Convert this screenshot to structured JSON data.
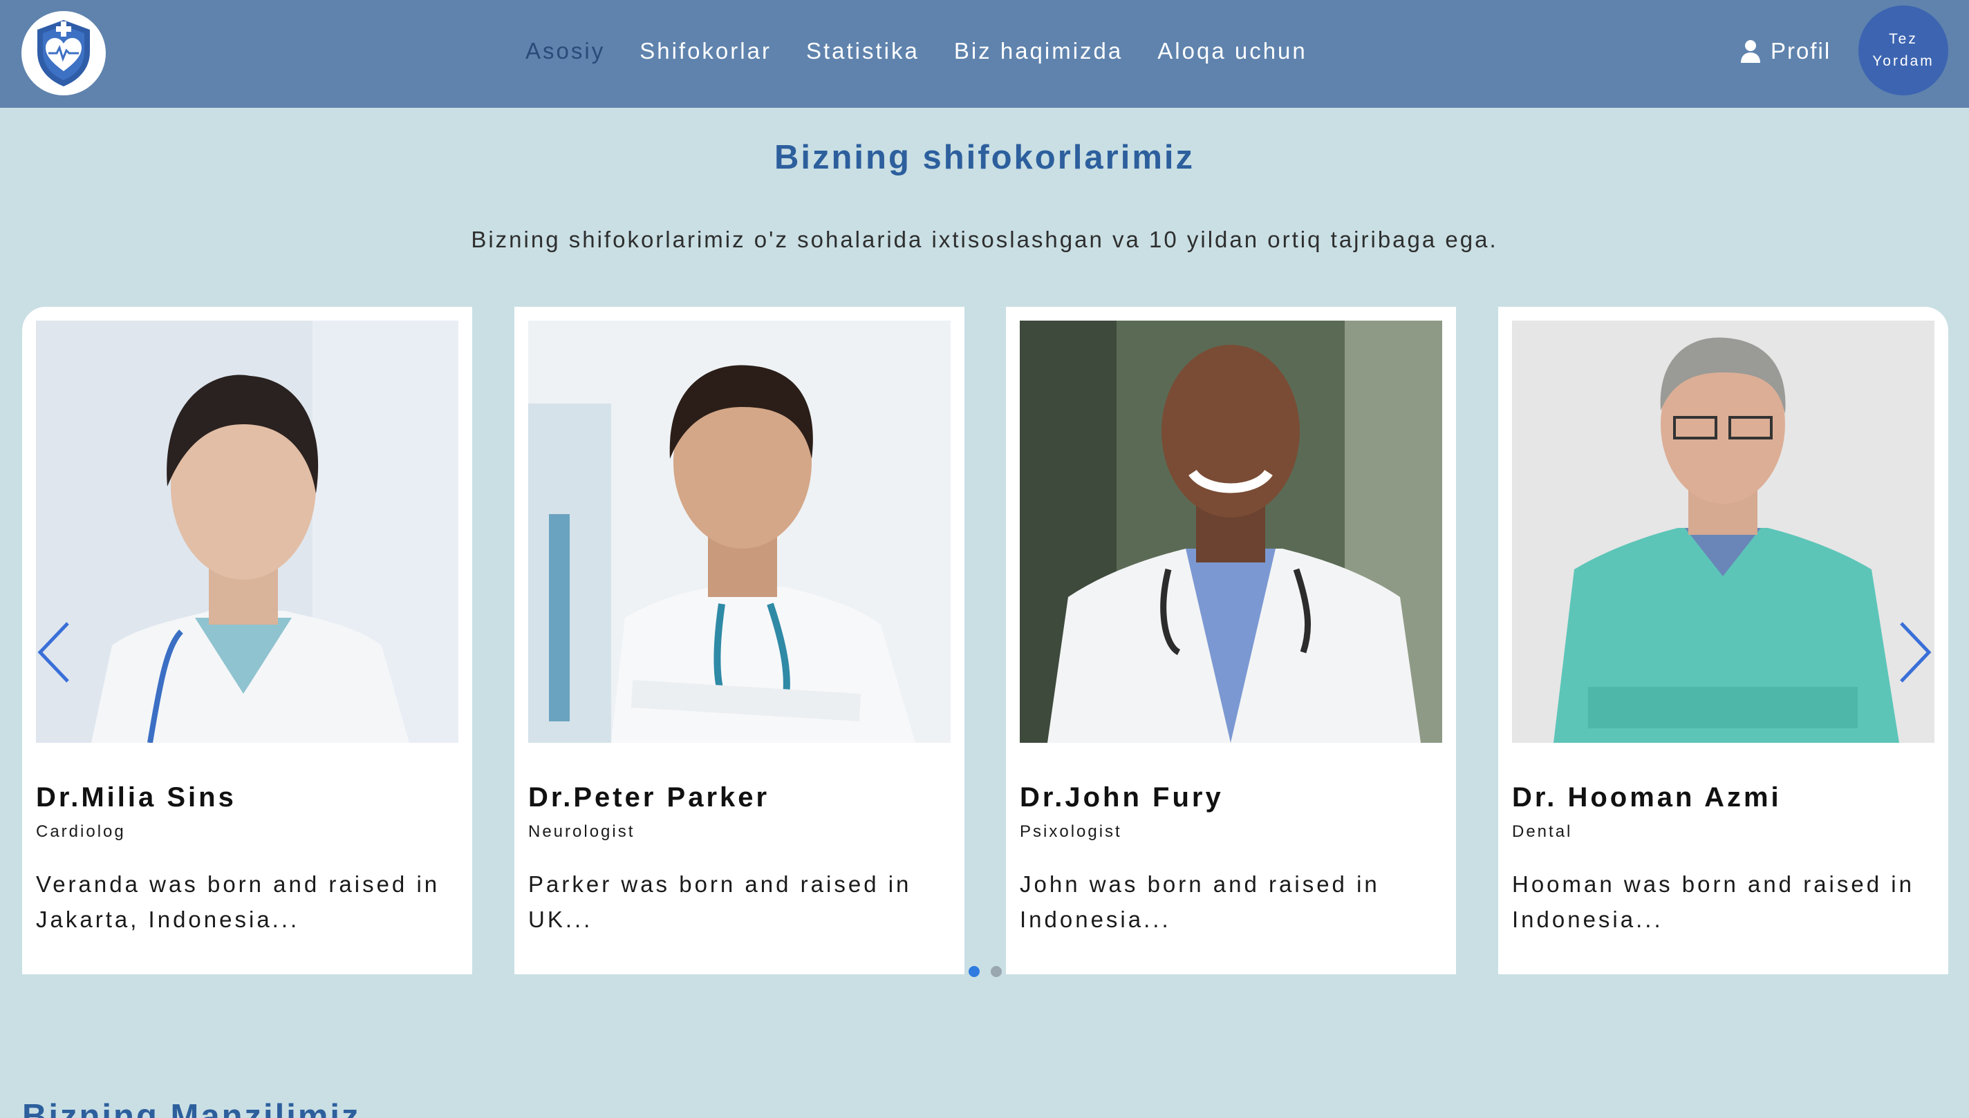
{
  "header": {
    "logo_icon": "shield-heart-cross-icon",
    "nav": [
      {
        "label": "Asosiy",
        "active": true
      },
      {
        "label": "Shifokorlar",
        "active": false
      },
      {
        "label": "Statistika",
        "active": false
      },
      {
        "label": "Biz haqimizda",
        "active": false
      },
      {
        "label": "Aloqa uchun",
        "active": false
      }
    ],
    "profile_label": "Profil",
    "emergency": {
      "line1": "Tez",
      "line2": "Yordam"
    }
  },
  "section": {
    "title": "Bizning shifokorlarimiz",
    "subtitle": "Bizning shifokorlarimiz o'z sohalarida ixtisoslashgan va 10 yildan ortiq tajribaga ega."
  },
  "doctors": [
    {
      "name": "Dr.Milia Sins",
      "specialty": "Cardiolog",
      "bio": "Veranda was born and raised in Jakarta, Indonesia..."
    },
    {
      "name": "Dr.Peter Parker",
      "specialty": "Neurologist",
      "bio": "Parker was born and raised in UK..."
    },
    {
      "name": "Dr.John Fury",
      "specialty": "Psixologist",
      "bio": "John was born and raised in Indonesia..."
    },
    {
      "name": "Dr. Hooman Azmi",
      "specialty": "Dental",
      "bio": "Hooman was born and raised in Indonesia..."
    }
  ],
  "carousel": {
    "pages": 2,
    "active_page": 1
  },
  "next_section_title": "Bizning Manzilimiz",
  "colors": {
    "header_bg": "#5f83ad",
    "page_bg": "#c9dfe4",
    "title": "#2d5f9d",
    "emergency_bg": "#3c64b1",
    "arrow": "#3a6fd8"
  }
}
